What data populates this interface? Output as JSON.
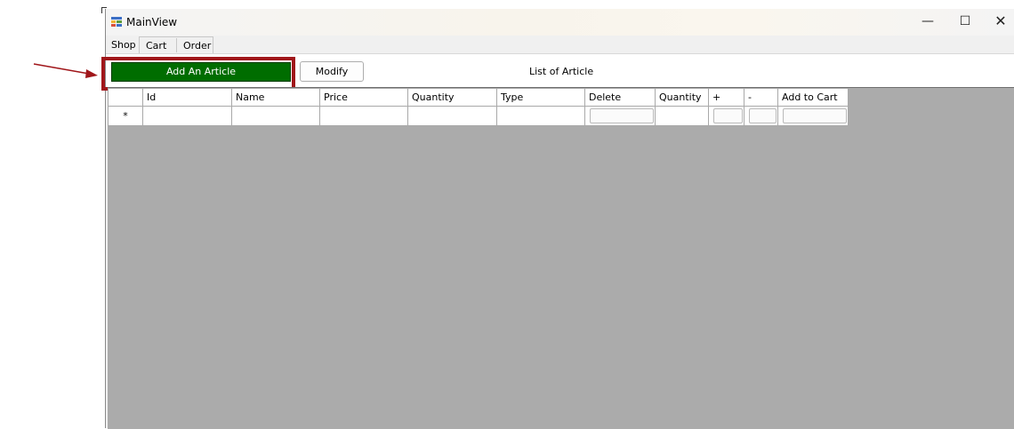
{
  "window": {
    "title": "MainView",
    "controls": {
      "minimize": "—",
      "maximize": "☐",
      "close": "✕"
    }
  },
  "menu": {
    "tabs": [
      "Shop",
      "Cart",
      "Order"
    ]
  },
  "toolbar": {
    "add_label": "Add An Article",
    "modify_label": "Modify",
    "list_title": "List of Article"
  },
  "grid": {
    "columns": [
      "Id",
      "Name",
      "Price",
      "Quantity",
      "Type",
      "Delete",
      "Quantity",
      "+",
      "-",
      "Add to Cart"
    ],
    "new_row_marker": "*"
  },
  "colors": {
    "add_button": "#006d00",
    "highlight": "#a0161a",
    "grid_background": "#ababab"
  },
  "icons": [
    "app-icon",
    "arrow-annotation"
  ]
}
